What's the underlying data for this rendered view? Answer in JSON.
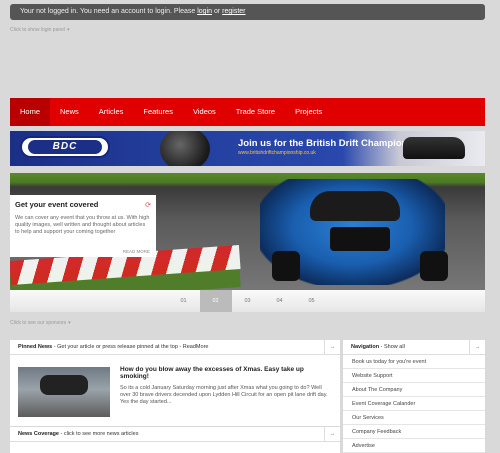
{
  "login_bar": {
    "prefix": "Your not logged in. You need an account to login. Please",
    "login_link": "login",
    "connector": "or",
    "register_link": "register"
  },
  "panel_toggle": "Click to show login panel",
  "nav": {
    "items": [
      {
        "label": "Home",
        "active": true
      },
      {
        "label": "News"
      },
      {
        "label": "Articles"
      },
      {
        "label": "Features"
      },
      {
        "label": "Videos"
      },
      {
        "label": "Trade Store"
      },
      {
        "label": "Projects"
      }
    ]
  },
  "banner": {
    "logo_text": "BDC",
    "headline": "Join us for the British Drift Championship",
    "url": "www.britishdriftchampionship.co.uk"
  },
  "slider": {
    "caption_title": "Get your event covered",
    "caption_text": "We can cover any event that you throw at us. With high quality images, well written and thought about articles to help and support your coming together",
    "read_more": "READ MORE",
    "pages": [
      "01",
      "02",
      "03",
      "04",
      "05"
    ],
    "active_page": "02"
  },
  "sponsor_toggle": "Click to see our sponsors",
  "pinned": {
    "heading": "Pinned News",
    "subheading": "Get your article or press release pinned at the top - ReadMore",
    "post_title": "How do you blow away the excesses of Xmas. Easy take up smoking!",
    "post_body": "So its a cold January Saturday morning just after Xmas what you going to do? Well over 30 brave drivers decended upon Lydden Hill Circuit for an open pit lane drift day. Yes the day started..."
  },
  "news": {
    "heading": "News Coverage",
    "subheading": "click to see more news articles"
  },
  "sidenav": {
    "heading": "Navigation",
    "show_all": "Show all",
    "items": [
      "Book us today for you're event",
      "Website Support",
      "About The Company",
      "Event Coverage Calander",
      "Our Services",
      "Company Feedback",
      "Advertise"
    ]
  }
}
